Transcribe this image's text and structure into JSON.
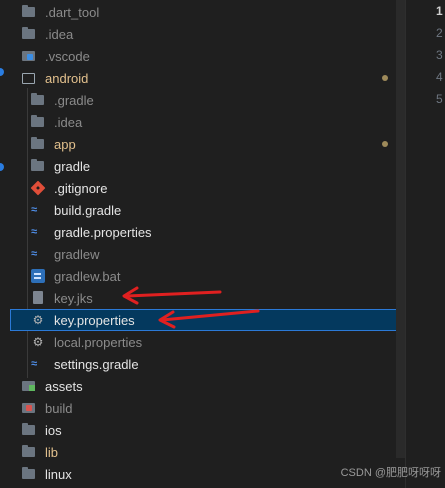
{
  "tree": [
    {
      "label": ".dart_tool",
      "icon": "folder-icon",
      "tone": "muted"
    },
    {
      "label": ".idea",
      "icon": "folder-icon",
      "tone": "muted"
    },
    {
      "label": ".vscode",
      "icon": "vscode-folder-icon",
      "tone": "muted"
    },
    {
      "label": "android",
      "icon": "folder-open-icon",
      "tone": "yellow"
    },
    {
      "label": ".gradle",
      "icon": "folder-icon",
      "tone": "muted"
    },
    {
      "label": ".idea",
      "icon": "folder-icon",
      "tone": "muted"
    },
    {
      "label": "app",
      "icon": "folder-icon",
      "tone": "yellow"
    },
    {
      "label": "gradle",
      "icon": "folder-icon",
      "tone": "white"
    },
    {
      "label": ".gitignore",
      "icon": "git-icon",
      "tone": "white"
    },
    {
      "label": "build.gradle",
      "icon": "gradle-icon",
      "tone": "white"
    },
    {
      "label": "gradle.properties",
      "icon": "gradle-icon",
      "tone": "white"
    },
    {
      "label": "gradlew",
      "icon": "gradle-icon",
      "tone": "muted"
    },
    {
      "label": "gradlew.bat",
      "icon": "bat-icon",
      "tone": "muted"
    },
    {
      "label": "key.jks",
      "icon": "file-icon",
      "tone": "muted"
    },
    {
      "label": "key.properties",
      "icon": "gear-icon",
      "tone": "white",
      "selected": true
    },
    {
      "label": "local.properties",
      "icon": "gear-icon",
      "tone": "muted"
    },
    {
      "label": "settings.gradle",
      "icon": "gradle-icon",
      "tone": "white"
    },
    {
      "label": "assets",
      "icon": "assets-folder-icon",
      "tone": "white"
    },
    {
      "label": "build",
      "icon": "build-folder-icon",
      "tone": "muted"
    },
    {
      "label": "ios",
      "icon": "folder-icon",
      "tone": "white"
    },
    {
      "label": "lib",
      "icon": "folder-icon",
      "tone": "yellow"
    },
    {
      "label": "linux",
      "icon": "folder-icon",
      "tone": "white"
    }
  ],
  "line_numbers": [
    "1",
    "2",
    "3",
    "4",
    "5"
  ],
  "watermark": "CSDN @肥肥呀呀呀",
  "colors": {
    "background": "#1f1f1f",
    "selection": "#04395e",
    "arrow": "#e02020",
    "modified_text": "#e2c08d"
  }
}
